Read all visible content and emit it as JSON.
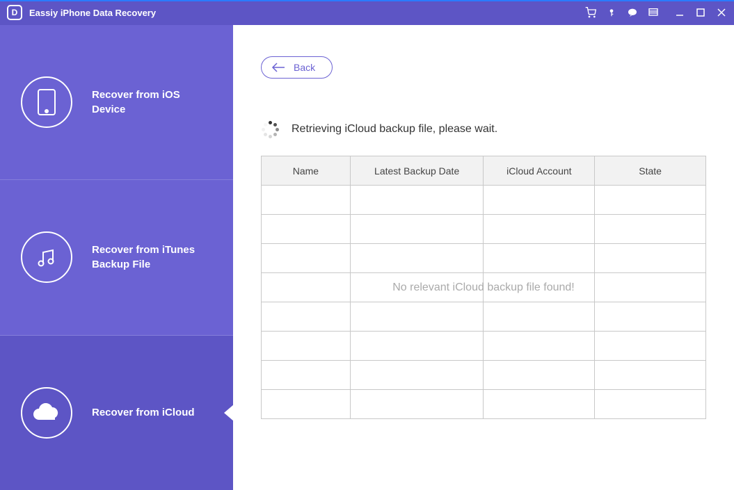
{
  "titlebar": {
    "title": "Eassiy iPhone Data Recovery",
    "logo_letter": "D"
  },
  "sidebar": {
    "items": [
      {
        "label": "Recover from iOS Device",
        "icon": "phone"
      },
      {
        "label": "Recover from iTunes Backup File",
        "icon": "music"
      },
      {
        "label": "Recover from iCloud",
        "icon": "cloud"
      }
    ]
  },
  "main": {
    "back_label": "Back",
    "status_text": "Retrieving iCloud backup file, please wait.",
    "table": {
      "headers": [
        "Name",
        "Latest Backup Date",
        "iCloud Account",
        "State"
      ],
      "empty_message": "No relevant iCloud backup file found!"
    }
  }
}
